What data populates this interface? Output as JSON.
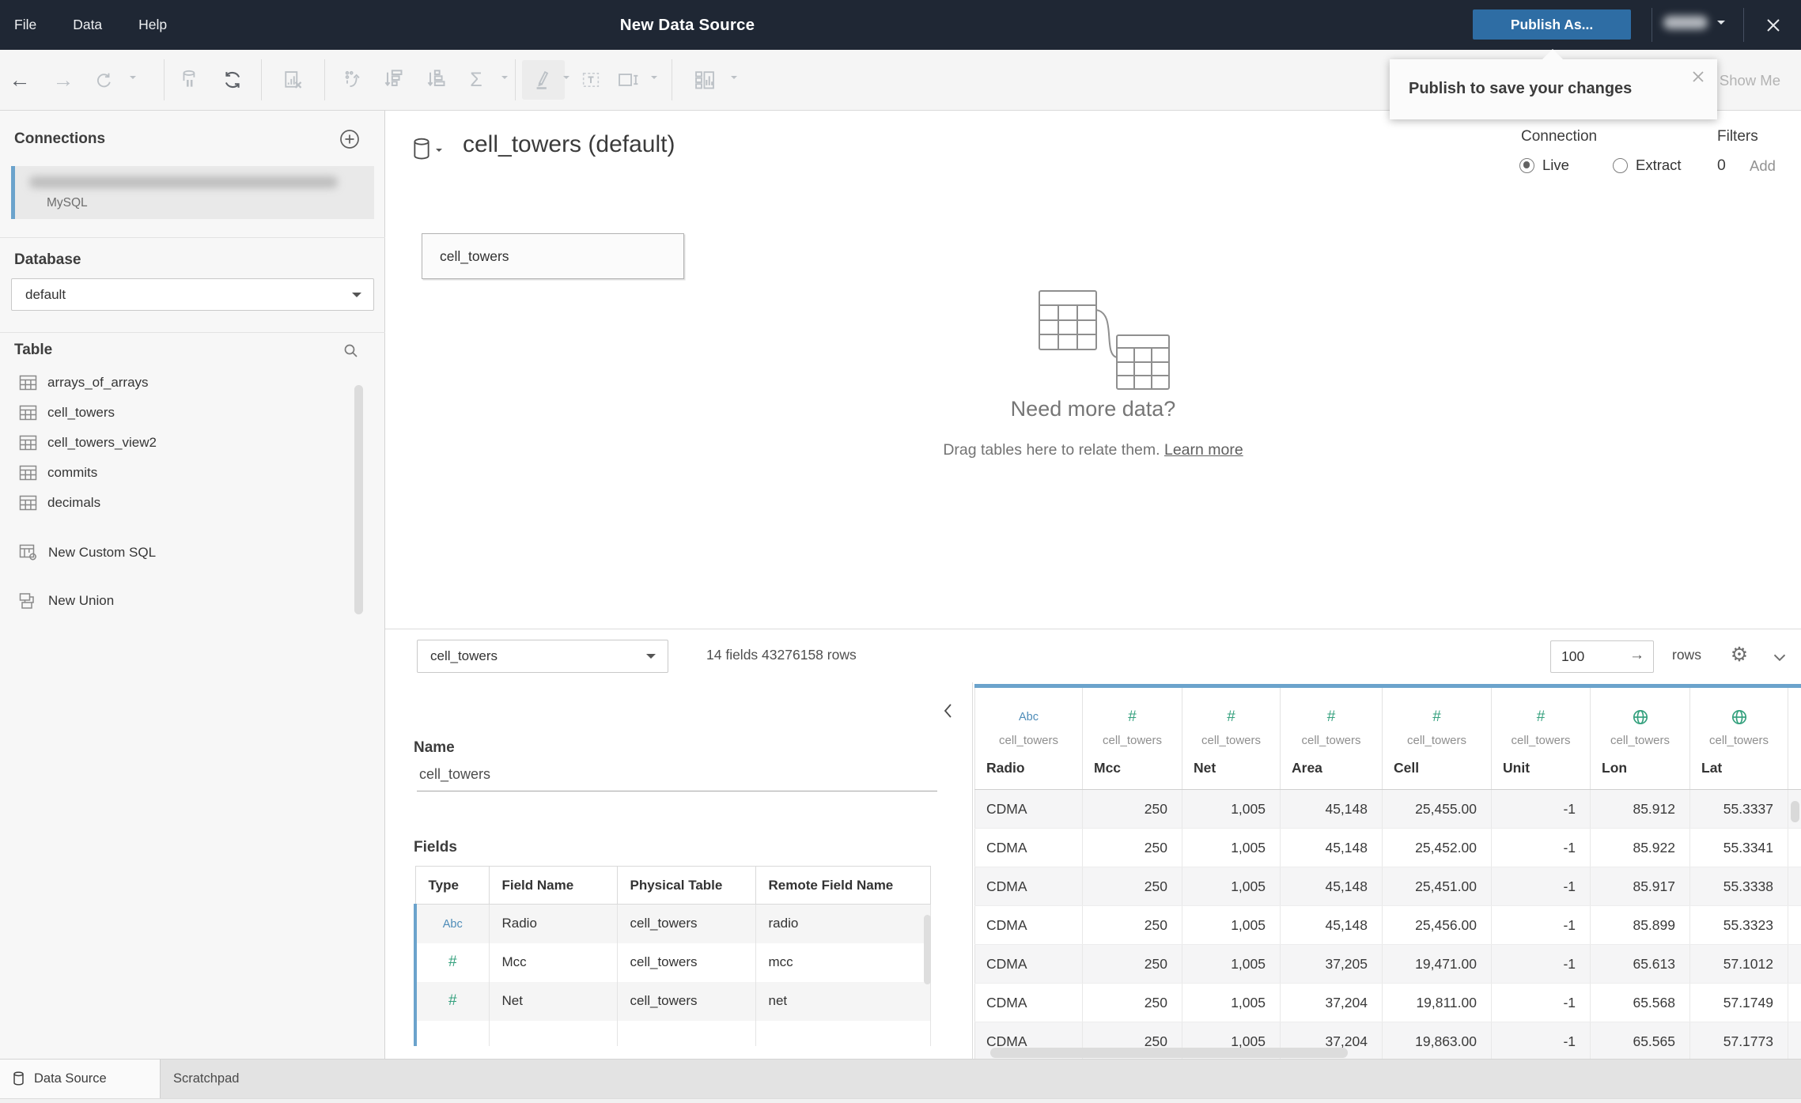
{
  "window": {
    "title": "New Data Source",
    "menus": [
      {
        "label": "File"
      },
      {
        "label": "Data"
      },
      {
        "label": "Help"
      }
    ],
    "publish_button": "Publish As...",
    "tooltip_text": "Publish to save your changes"
  },
  "toolbar": {
    "show_me": "Show Me"
  },
  "sidebar": {
    "connections_title": "Connections",
    "connection": {
      "subtitle": "MySQL"
    },
    "database_title": "Database",
    "database_selected": "default",
    "table_title": "Table",
    "table_items": [
      "arrays_of_arrays",
      "cell_towers",
      "cell_towers_view2",
      "commits",
      "decimals"
    ],
    "actions": [
      {
        "label": "New Custom SQL"
      },
      {
        "label": "New Union"
      }
    ]
  },
  "canvas": {
    "datasource_title": "cell_towers (default)",
    "node_label": "cell_towers",
    "connection_label": "Connection",
    "connection_options": [
      {
        "label": "Live",
        "selected": true
      },
      {
        "label": "Extract",
        "selected": false
      }
    ],
    "filters_label": "Filters",
    "filters_count": "0",
    "filters_add": "Add",
    "empty_heading": "Need more data?",
    "empty_body": "Drag tables here to relate them.",
    "empty_link": "Learn more"
  },
  "preview_bar": {
    "table_selector": "cell_towers",
    "summary": "14 fields 43276158 rows",
    "row_count": "100",
    "go_arrow": "→",
    "rows_label": "rows"
  },
  "metadata_panel": {
    "name_label": "Name",
    "name_value": "cell_towers",
    "fields_label": "Fields",
    "columns": [
      "Type",
      "Field Name",
      "Physical Table",
      "Remote Field Name"
    ],
    "rows": [
      {
        "type_icon": "Abc",
        "icon_class": "abc",
        "icon_name": "string-type-icon",
        "field": "Radio",
        "physical_table": "cell_towers",
        "remote": "radio"
      },
      {
        "type_icon": "#",
        "icon_class": "hash",
        "icon_name": "number-type-icon",
        "field": "Mcc",
        "physical_table": "cell_towers",
        "remote": "mcc"
      },
      {
        "type_icon": "#",
        "icon_class": "hash",
        "icon_name": "number-type-icon",
        "field": "Net",
        "physical_table": "cell_towers",
        "remote": "net"
      }
    ]
  },
  "data_grid": {
    "table_label": "cell_towers",
    "fields": [
      {
        "name": "Radio",
        "type_icon": "Abc",
        "icon_class": "abc",
        "icon_name": "string-type-icon"
      },
      {
        "name": "Mcc",
        "type_icon": "#",
        "icon_class": "hash",
        "icon_name": "number-type-icon"
      },
      {
        "name": "Net",
        "type_icon": "#",
        "icon_class": "hash",
        "icon_name": "number-type-icon"
      },
      {
        "name": "Area",
        "type_icon": "#",
        "icon_class": "hash",
        "icon_name": "number-type-icon"
      },
      {
        "name": "Cell",
        "type_icon": "#",
        "icon_class": "hash",
        "icon_name": "number-type-icon"
      },
      {
        "name": "Unit",
        "type_icon": "#",
        "icon_class": "hash",
        "icon_name": "number-type-icon"
      },
      {
        "name": "Lon",
        "type_icon": "",
        "icon_class": "globe",
        "icon_name": "geo-type-icon"
      },
      {
        "name": "Lat",
        "type_icon": "",
        "icon_class": "globe",
        "icon_name": "geo-type-icon"
      }
    ],
    "rows": [
      [
        "CDMA",
        "250",
        "1,005",
        "45,148",
        "25,455.00",
        "-1",
        "85.912",
        "55.3337"
      ],
      [
        "CDMA",
        "250",
        "1,005",
        "45,148",
        "25,452.00",
        "-1",
        "85.922",
        "55.3341"
      ],
      [
        "CDMA",
        "250",
        "1,005",
        "45,148",
        "25,451.00",
        "-1",
        "85.917",
        "55.3338"
      ],
      [
        "CDMA",
        "250",
        "1,005",
        "45,148",
        "25,456.00",
        "-1",
        "85.899",
        "55.3323"
      ],
      [
        "CDMA",
        "250",
        "1,005",
        "37,205",
        "19,471.00",
        "-1",
        "65.613",
        "57.1012"
      ],
      [
        "CDMA",
        "250",
        "1,005",
        "37,204",
        "19,811.00",
        "-1",
        "65.568",
        "57.1749"
      ],
      [
        "CDMA",
        "250",
        "1,005",
        "37,204",
        "19,863.00",
        "-1",
        "65.565",
        "57.1773"
      ]
    ]
  },
  "status_bar": {
    "tabs": [
      {
        "label": "Data Source",
        "active": true
      },
      {
        "label": "Scratchpad",
        "active": false
      }
    ]
  },
  "colors": {
    "titlebar_bg": "#1f2734",
    "publish_blue": "#2e6da4",
    "accent_blue": "#6ba3cc",
    "type_green": "#35a17e",
    "type_blue": "#4e8cb8"
  }
}
